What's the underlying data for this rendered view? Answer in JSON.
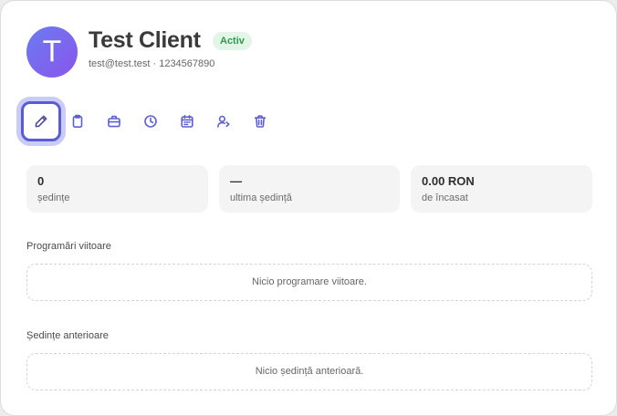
{
  "client": {
    "initial": "T",
    "name": "Test Client",
    "status": "Activ",
    "email": "test@test.test",
    "separator": " · ",
    "phone": "1234567890"
  },
  "toolbar": {
    "items": [
      {
        "icon": "pencil-icon",
        "label": "edit"
      },
      {
        "icon": "clipboard-icon",
        "label": "notes"
      },
      {
        "icon": "briefcase-icon",
        "label": "briefcase"
      },
      {
        "icon": "clock-icon",
        "label": "history"
      },
      {
        "icon": "calendar-icon",
        "label": "calendar"
      },
      {
        "icon": "user-share-icon",
        "label": "user"
      },
      {
        "icon": "trash-icon",
        "label": "delete"
      }
    ]
  },
  "stats": [
    {
      "value": "0",
      "label": "ședințe"
    },
    {
      "value": "—",
      "label": "ultima ședință"
    },
    {
      "value": "0.00 RON",
      "label": "de încasat"
    }
  ],
  "upcoming": {
    "title": "Programări viitoare",
    "empty": "Nicio programare viitoare."
  },
  "past": {
    "title": "Ședințe anterioare",
    "empty": "Nicio ședință anterioară."
  },
  "colors": {
    "accent": "#5b5bd6",
    "badge_bg": "#e3f5e7",
    "badge_text": "#2f9a4d"
  }
}
